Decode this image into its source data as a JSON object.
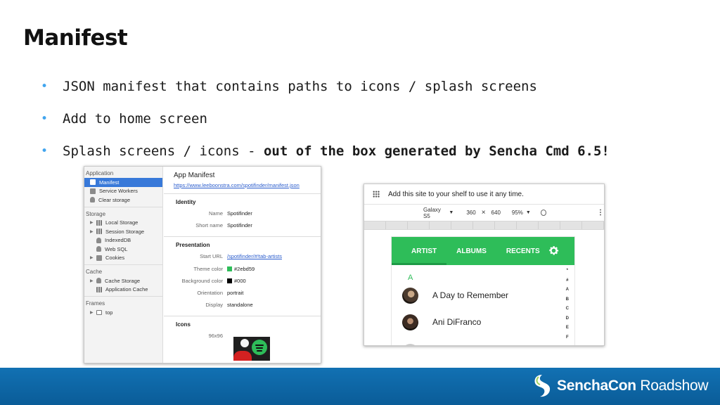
{
  "slide": {
    "title": "Manifest",
    "bullets": [
      {
        "text": "JSON manifest that contains paths to icons / splash screens",
        "bold": ""
      },
      {
        "text": "Add to home screen",
        "bold": ""
      },
      {
        "text": "Splash screens / icons - ",
        "bold": "out of the box generated by Sencha Cmd 6.5!"
      }
    ]
  },
  "devtools": {
    "sidebar": {
      "application_label": "Application",
      "application_items": [
        "Manifest",
        "Service Workers",
        "Clear storage"
      ],
      "storage_label": "Storage",
      "storage_items": [
        "Local Storage",
        "Session Storage",
        "IndexedDB",
        "Web SQL",
        "Cookies"
      ],
      "cache_label": "Cache",
      "cache_items": [
        "Cache Storage",
        "Application Cache"
      ],
      "frames_label": "Frames",
      "frames_items": [
        "top"
      ]
    },
    "main": {
      "heading": "App Manifest",
      "url": "https://www.leeboonstra.com/spotifinder/manifest.json",
      "identity_label": "Identity",
      "identity": [
        {
          "key": "Name",
          "value": "Spotifinder"
        },
        {
          "key": "Short name",
          "value": "Spotifinder"
        }
      ],
      "presentation_label": "Presentation",
      "presentation": [
        {
          "key": "Start URL",
          "value": "/spotifinder/#!tab-artists"
        },
        {
          "key": "Theme color",
          "value": "#2ebd59"
        },
        {
          "key": "Background color",
          "value": "#000"
        },
        {
          "key": "Orientation",
          "value": "portrait"
        },
        {
          "key": "Display",
          "value": "standalone"
        }
      ],
      "icons_label": "Icons",
      "icon_size": "96x96"
    }
  },
  "emulator": {
    "message": "Add this site to your shelf to use it any time.",
    "device": "Galaxy S5",
    "width": "360",
    "times": "×",
    "height": "640",
    "zoom": "95%",
    "tabs": [
      "ARTIST",
      "ALBUMS",
      "RECENTS"
    ],
    "letter": "A",
    "artists": [
      "A Day to Remember",
      "Ani DiFranco"
    ],
    "index": [
      "*",
      "#",
      "A",
      "B",
      "C",
      "D",
      "E",
      "F"
    ]
  },
  "footer": {
    "brand_bold": "SenchaCon",
    "brand_light": " Roadshow"
  },
  "colors": {
    "accent_blue": "#41a5ee",
    "spotify_green": "#2ebd59",
    "footer_blue": "#0a5c98"
  }
}
